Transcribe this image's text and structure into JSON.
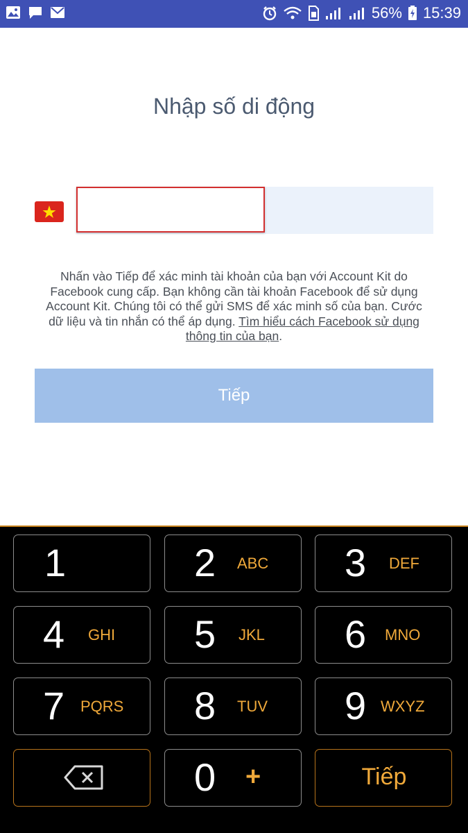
{
  "status_bar": {
    "battery": "56%",
    "time": "15:39"
  },
  "title": "Nhập số di động",
  "phone": {
    "country_flag": "vietnam-flag-icon",
    "value": ""
  },
  "disclaimer": {
    "text": "Nhấn vào Tiếp để xác minh tài khoản của bạn với Account Kit do Facebook cung cấp. Bạn không cần tài khoản Facebook để sử dụng Account Kit. Chúng tôi có thể gửi SMS để xác minh số của bạn. Cước dữ liệu và tin nhắn có thể áp dụng. ",
    "link": "Tìm hiểu cách Facebook sử dụng thông tin của bạn",
    "end": "."
  },
  "next_button": "Tiếp",
  "keypad": {
    "keys": [
      {
        "digit": "1",
        "letters": ""
      },
      {
        "digit": "2",
        "letters": "ABC"
      },
      {
        "digit": "3",
        "letters": "DEF"
      },
      {
        "digit": "4",
        "letters": "GHI"
      },
      {
        "digit": "5",
        "letters": "JKL"
      },
      {
        "digit": "6",
        "letters": "MNO"
      },
      {
        "digit": "7",
        "letters": "PQRS"
      },
      {
        "digit": "8",
        "letters": "TUV"
      },
      {
        "digit": "9",
        "letters": "WXYZ"
      },
      {
        "digit": "0",
        "letters": "+"
      }
    ],
    "go_label": "Tiếp"
  },
  "colors": {
    "status_bar": "#3f51b5",
    "button_disabled": "#9fbfe9",
    "keypad_accent": "#f0a93a",
    "input_error": "#d32f2f"
  }
}
